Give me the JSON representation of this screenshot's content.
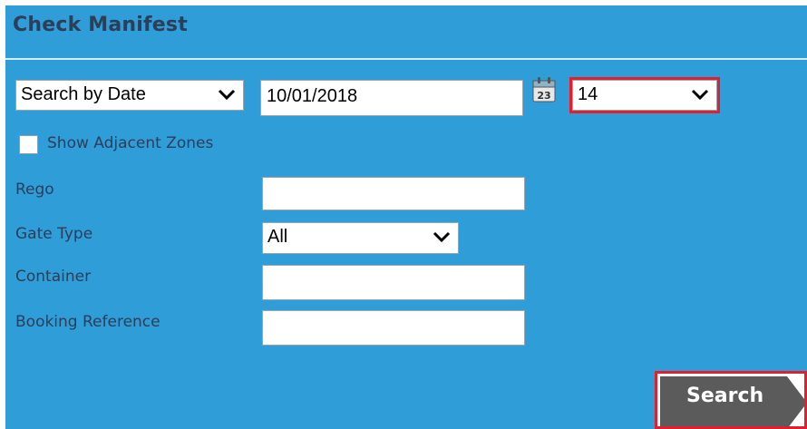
{
  "header": {
    "title": "Check Manifest"
  },
  "search_mode": {
    "selected": "Search by Date"
  },
  "date": {
    "value": "10/01/2018",
    "calendar_icon_text": "23"
  },
  "days": {
    "selected": "14"
  },
  "adjacent_zones": {
    "label": "Show Adjacent Zones",
    "checked": false
  },
  "fields": {
    "rego_label": "Rego",
    "rego_value": "",
    "gate_type_label": "Gate Type",
    "gate_type_selected": "All",
    "container_label": "Container",
    "container_value": "",
    "booking_label": "Booking Reference",
    "booking_value": ""
  },
  "actions": {
    "search_label": "Search"
  },
  "colors": {
    "panel_bg": "#2f9dd8",
    "title_text": "#2c3e58",
    "highlight": "#e0202e",
    "button_bg": "#5b5b5b"
  },
  "icons": {
    "calendar": "calendar-icon",
    "chevron": "chevron-down-icon",
    "checkbox": "checkbox-icon"
  }
}
